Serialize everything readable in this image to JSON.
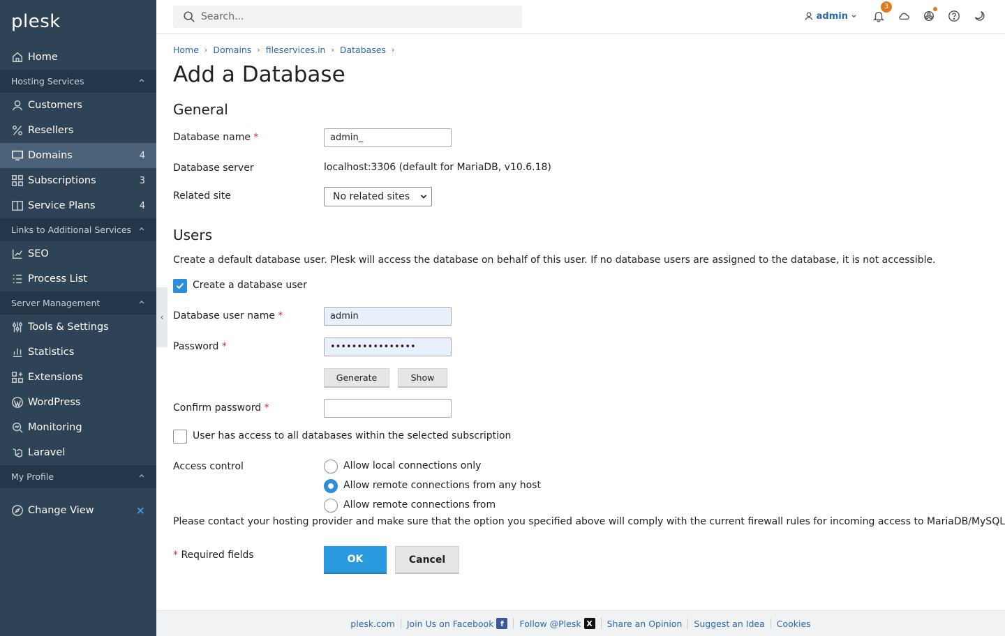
{
  "sidebar": {
    "logo": "plesk",
    "home": "Home",
    "sections": {
      "hosting": "Hosting Services",
      "links": "Links to Additional Services",
      "server": "Server Management",
      "profile": "My Profile"
    },
    "hosting_items": [
      {
        "label": "Customers",
        "count": ""
      },
      {
        "label": "Resellers",
        "count": ""
      },
      {
        "label": "Domains",
        "count": "4"
      },
      {
        "label": "Subscriptions",
        "count": "3"
      },
      {
        "label": "Service Plans",
        "count": "4"
      }
    ],
    "links_items": [
      {
        "label": "SEO"
      },
      {
        "label": "Process List"
      }
    ],
    "server_items": [
      {
        "label": "Tools & Settings"
      },
      {
        "label": "Statistics"
      },
      {
        "label": "Extensions"
      },
      {
        "label": "WordPress"
      },
      {
        "label": "Monitoring"
      },
      {
        "label": "Laravel"
      }
    ],
    "change_view": "Change View"
  },
  "topbar": {
    "search_placeholder": "Search...",
    "user": "admin",
    "notification_count": "3"
  },
  "breadcrumb": [
    "Home",
    "Domains",
    "fileservices.in",
    "Databases"
  ],
  "page_title": "Add a Database",
  "general": {
    "heading": "General",
    "db_name_label": "Database name",
    "db_name_value": "admin_",
    "db_server_label": "Database server",
    "db_server_value": "localhost:3306 (default for MariaDB, v10.6.18)",
    "related_site_label": "Related site",
    "related_site_value": "No related sites"
  },
  "users": {
    "heading": "Users",
    "description": "Create a default database user. Plesk will access the database on behalf of this user. If no database users are assigned to the database, it is not accessible.",
    "create_user_label": "Create a database user",
    "create_user_checked": true,
    "username_label": "Database user name",
    "username_value": "admin",
    "password_label": "Password",
    "password_value": "••••••••••••••••",
    "generate_button": "Generate",
    "show_button": "Show",
    "confirm_label": "Confirm password",
    "confirm_value": "",
    "all_db_access_label": "User has access to all databases within the selected subscription",
    "access_control_label": "Access control",
    "access_options": [
      {
        "label": "Allow local connections only",
        "checked": false
      },
      {
        "label": "Allow remote connections from any host",
        "checked": true
      },
      {
        "label": "Allow remote connections from",
        "checked": false
      }
    ],
    "firewall_note": "Please contact your hosting provider and make sure that the option you specified above will comply with the current firewall rules for incoming access to MariaDB/MySQL."
  },
  "form": {
    "required_note": "Required fields",
    "ok_button": "OK",
    "cancel_button": "Cancel"
  },
  "footer": {
    "links": [
      "plesk.com",
      "Join Us on Facebook",
      "Follow @Plesk",
      "Share an Opinion",
      "Suggest an Idea",
      "Cookies"
    ]
  },
  "colors": {
    "sidebar_bg": "#2f4356",
    "accent": "#2a9ae0",
    "link": "#2a6aaa",
    "badge": "#e07b1b"
  }
}
